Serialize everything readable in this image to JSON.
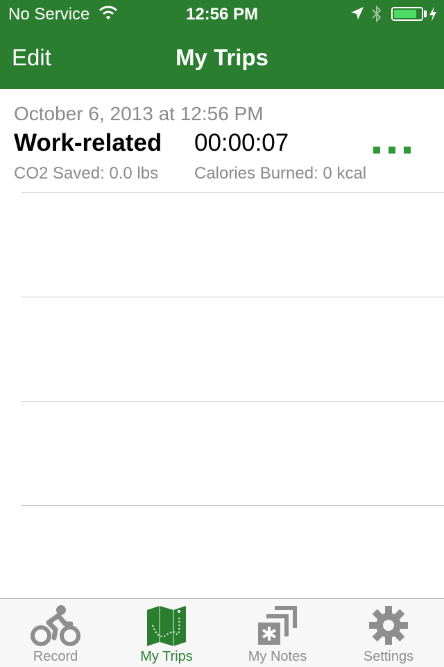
{
  "status_bar": {
    "carrier": "No Service",
    "time": "12:56 PM",
    "battery_level": 0.85,
    "icons": [
      "wifi-icon",
      "location-arrow-icon",
      "bluetooth-icon",
      "battery-icon",
      "charging-bolt-icon"
    ]
  },
  "nav_bar": {
    "edit_label": "Edit",
    "title": "My Trips",
    "background_color": "#2b7d2f"
  },
  "trips": [
    {
      "date": "October 6, 2013 at 12:56 PM",
      "purpose": "Work-related",
      "duration": "00:00:07",
      "co2": "CO2 Saved: 0.0 lbs",
      "calories": "Calories Burned: 0 kcal",
      "status_icon": "upload-pending-dots-icon"
    }
  ],
  "tab_bar": {
    "tabs": [
      {
        "label": "Record",
        "icon": "bicycle-rider-icon",
        "active": false
      },
      {
        "label": "My Trips",
        "icon": "trail-map-icon",
        "active": true
      },
      {
        "label": "My Notes",
        "icon": "notes-stack-icon",
        "active": false
      },
      {
        "label": "Settings",
        "icon": "gear-icon",
        "active": false
      }
    ],
    "active_color": "#2b7d2f",
    "inactive_color": "#8e8e8e"
  }
}
